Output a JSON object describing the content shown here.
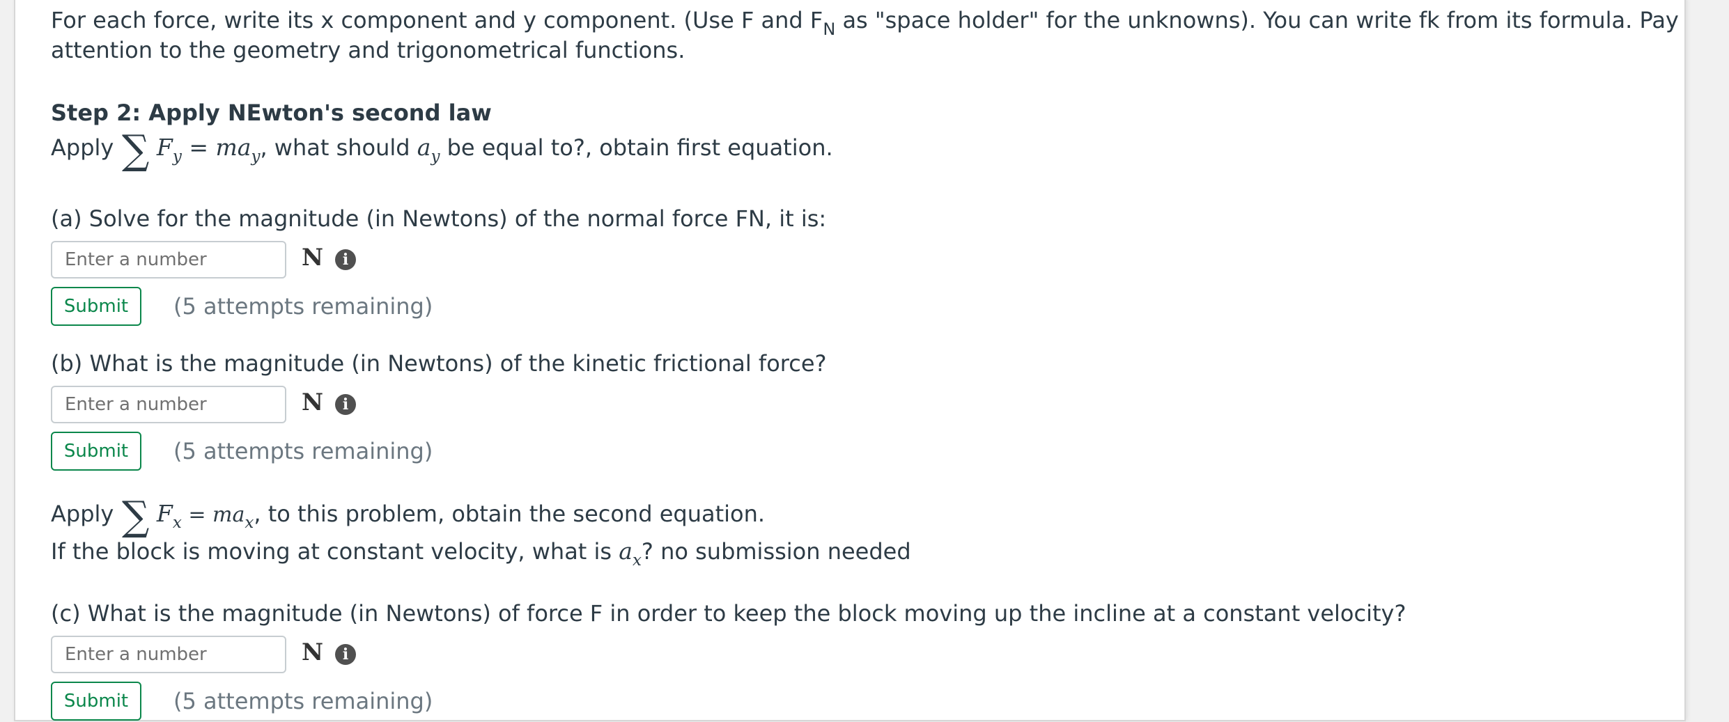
{
  "intro": {
    "line1_a": "For each force, write its x component and y component. (Use F and F",
    "line1_sub": "N",
    "line1_b": " as \"space holder\" for the unknowns). You can write fk from its formula. Pay",
    "line2": "attention to the geometry and trigonometrical functions."
  },
  "step2": {
    "heading": "Step 2: Apply NEwton's second law",
    "apply_word": "Apply",
    "sigma": "∑",
    "eq_lhs": "F",
    "eq_lhs_sub": "y",
    "eq_equals": " = ",
    "eq_rhs": "ma",
    "eq_rhs_sub": "y",
    "after_eq": ", what should ",
    "var": "a",
    "var_sub": "y",
    "tail": " be equal to?,  obtain first equation."
  },
  "parts": [
    {
      "question": "(a) Solve for the magnitude  (in Newtons) of the normal force FN, it is:",
      "placeholder": "Enter a number",
      "unit": "N",
      "submit_label": "Submit",
      "attempts": "(5 attempts remaining)"
    },
    {
      "question": "(b) What is the magnitude  (in Newtons) of the kinetic frictional force?",
      "placeholder": "Enter a number",
      "unit": "N",
      "submit_label": "Submit",
      "attempts": "(5 attempts remaining)"
    },
    {
      "question": "(c) What is the magnitude  (in Newtons) of force F in order to keep the block moving up the incline at a constant velocity?",
      "placeholder": "Enter a number",
      "unit": "N",
      "submit_label": "Submit",
      "attempts": "(5 attempts remaining)"
    }
  ],
  "xeq": {
    "apply_word": "Apply",
    "sigma": "∑",
    "eq_lhs": "F",
    "eq_lhs_sub": "x",
    "eq_equals": " = ",
    "eq_rhs": "ma",
    "eq_rhs_sub": "x",
    "tail": ", to this problem, obtain the second equation.",
    "line2_a": "If the block is moving at constant velocity, what is ",
    "var": "a",
    "var_sub": "x",
    "line2_b": "?  no submission needed"
  },
  "icons": {
    "info": "info-icon"
  },
  "colors": {
    "submit_accent": "#0b874b",
    "text": "#2d3b45",
    "muted": "#6b7780"
  }
}
